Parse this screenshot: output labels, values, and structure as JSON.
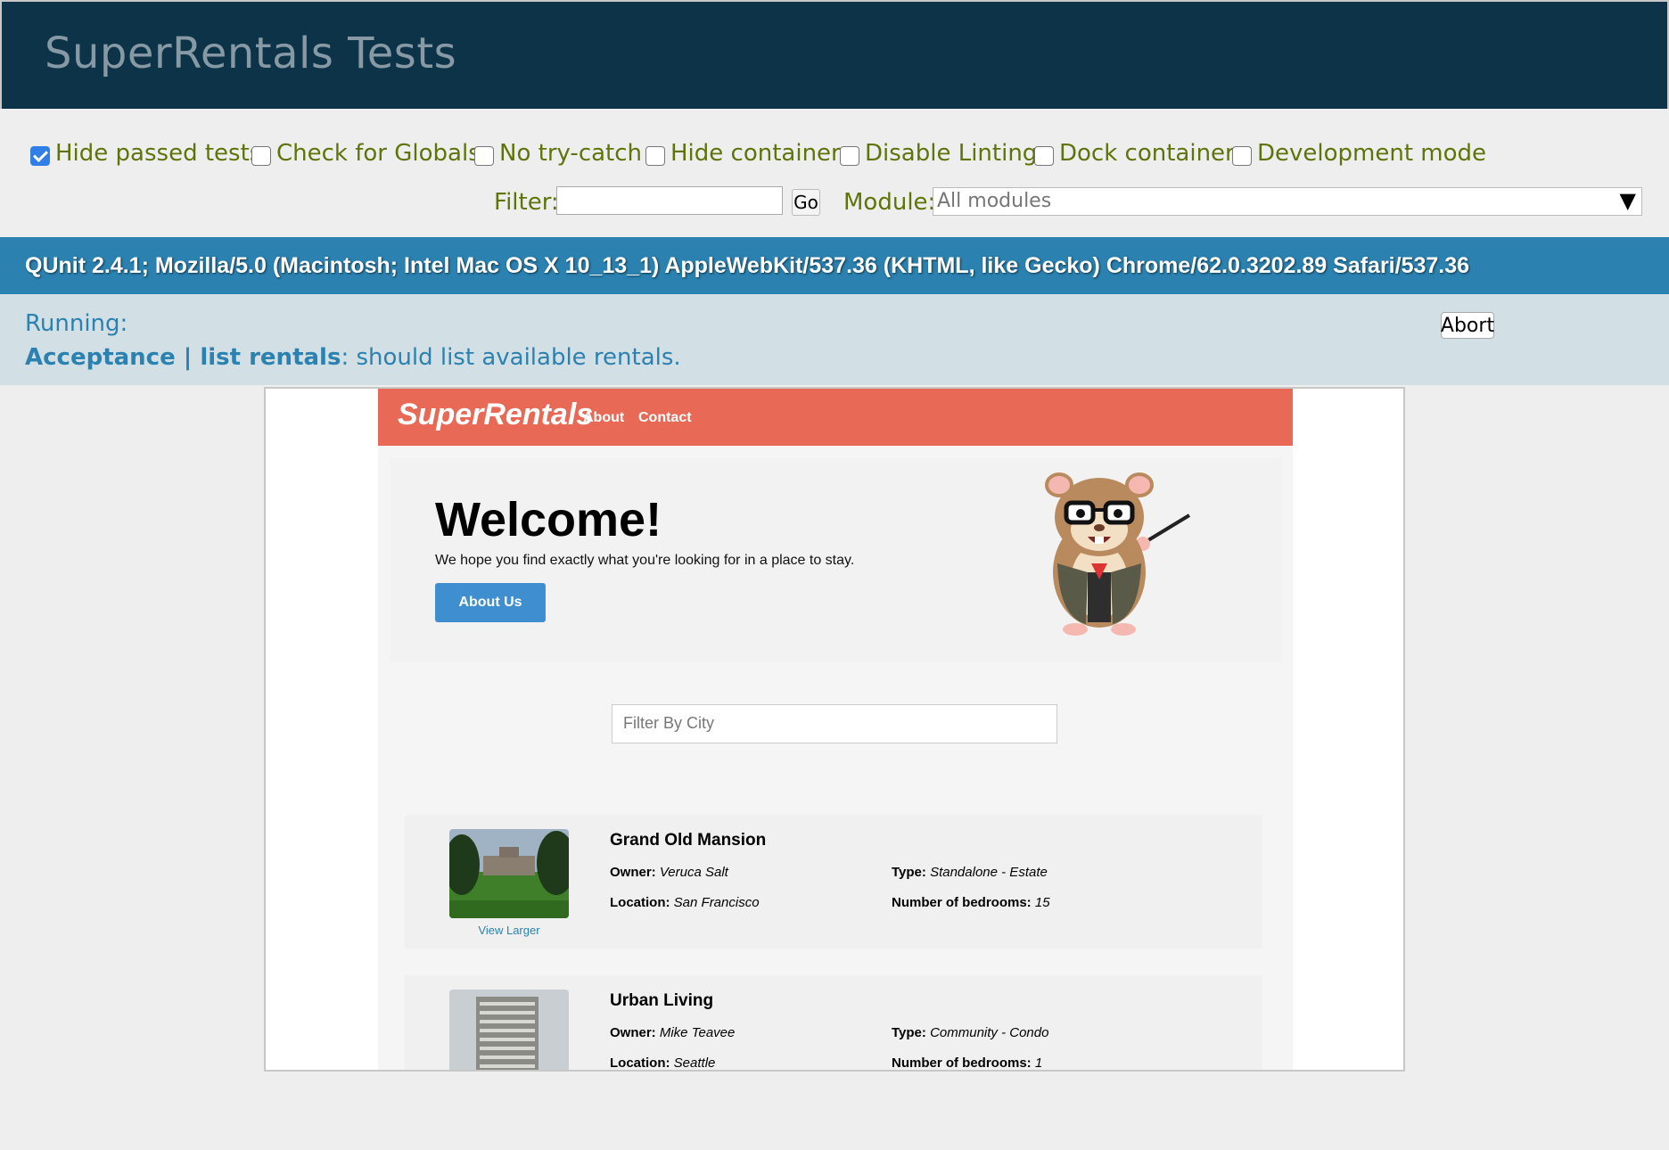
{
  "header": {
    "title": "SuperRentals Tests"
  },
  "toolbar": {
    "options": [
      {
        "label": "Hide passed tests",
        "checked": true
      },
      {
        "label": "Check for Globals",
        "checked": false
      },
      {
        "label": "No try-catch",
        "checked": false
      },
      {
        "label": "Hide container",
        "checked": false
      },
      {
        "label": "Disable Linting",
        "checked": false
      },
      {
        "label": "Dock container",
        "checked": false
      },
      {
        "label": "Development mode",
        "checked": false
      }
    ],
    "filter_label": "Filter:",
    "filter_value": "",
    "go_label": "Go",
    "module_label": "Module:",
    "module_value": "All modules",
    "dropdown_icon": "▼"
  },
  "user_agent": "QUnit 2.4.1; Mozilla/5.0 (Macintosh; Intel Mac OS X 10_13_1) AppleWebKit/537.36 (KHTML, like Gecko) Chrome/62.0.3202.89 Safari/537.36",
  "status": {
    "running": "Running:",
    "module": "Acceptance | list rentals",
    "test": ": should list available rentals.",
    "abort_label": "Abort"
  },
  "app": {
    "brand": "SuperRentals",
    "nav": [
      "About",
      "Contact"
    ],
    "welcome": "Welcome!",
    "tagline": "We hope you find exactly what you're looking for in a place to stay.",
    "about_button": "About Us",
    "filter_placeholder": "Filter By City",
    "rentals": [
      {
        "title": "Grand Old Mansion",
        "owner_label": "Owner:",
        "owner": "Veruca Salt",
        "type_label": "Type:",
        "type": "Standalone - Estate",
        "location_label": "Location:",
        "location": "San Francisco",
        "bedrooms_label": "Number of bedrooms:",
        "bedrooms": "15",
        "view_larger": "View Larger"
      },
      {
        "title": "Urban Living",
        "owner_label": "Owner:",
        "owner": "Mike Teavee",
        "type_label": "Type:",
        "type": "Community - Condo",
        "location_label": "Location:",
        "location": "Seattle",
        "bedrooms_label": "Number of bedrooms:",
        "bedrooms": "1"
      }
    ]
  },
  "colors": {
    "header_bg": "#0d3349",
    "ua_bg": "#2b81af",
    "status_bg": "#d2e0e6",
    "nav_bg": "#e76956",
    "button_bg": "#3e8ed0"
  }
}
